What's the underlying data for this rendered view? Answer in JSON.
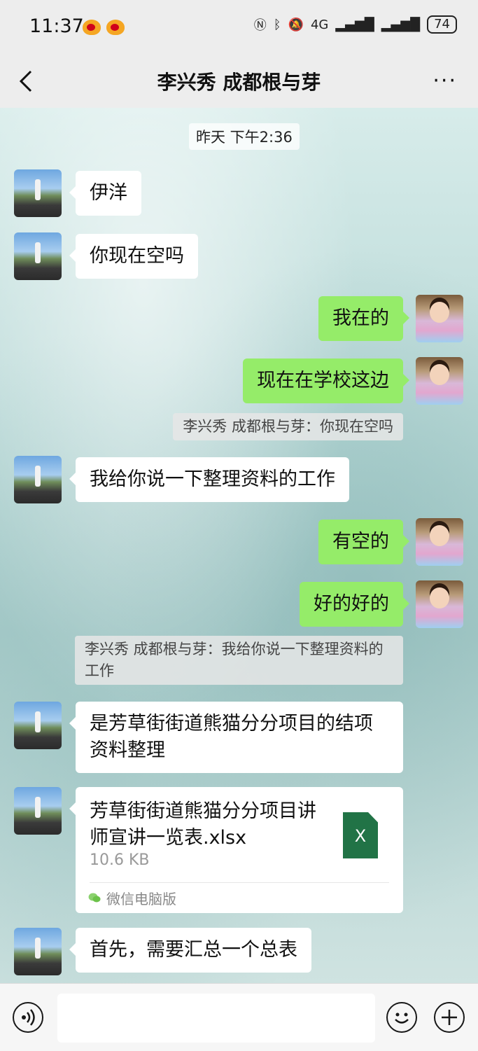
{
  "status_bar": {
    "time": "11:37",
    "signal_label": "4G",
    "battery": "74"
  },
  "header": {
    "title": "李兴秀 成都根与芽",
    "more_label": "···"
  },
  "chat": {
    "timestamp": "昨天 下午2:36",
    "messages": [
      {
        "text": "伊洋"
      },
      {
        "text": "你现在空吗"
      },
      {
        "text": "我在的"
      },
      {
        "text": "现在在学校这边"
      },
      {
        "text": "李兴秀 成都根与芽：你现在空吗"
      },
      {
        "text": "我给你说一下整理资料的工作"
      },
      {
        "text": "有空的"
      },
      {
        "text": "好的好的"
      },
      {
        "text": "李兴秀 成都根与芽：我给你说一下整理资料的工作"
      },
      {
        "text": "是芳草街街道熊猫分分项目的结项资料整理"
      },
      {
        "text": "首先，需要汇总一个总表"
      }
    ],
    "file": {
      "name": "芳草街街道熊猫分分项目讲师宣讲一览表.xlsx",
      "size": "10.6 KB",
      "icon_letter": "X",
      "source": "微信电脑版"
    }
  },
  "input": {
    "placeholder": ""
  },
  "colors": {
    "bubble_out": "#95ec69",
    "bubble_in": "#ffffff",
    "excel_green": "#217346"
  }
}
